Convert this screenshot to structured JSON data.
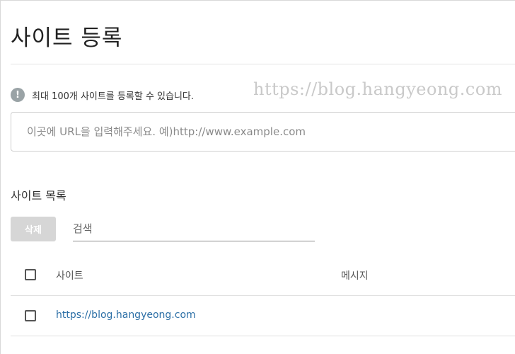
{
  "page": {
    "title": "사이트 등록"
  },
  "notice": {
    "icon": "exclamation-icon",
    "icon_glyph": "!",
    "text": "최대 100개 사이트를 등록할 수 있습니다."
  },
  "watermark": {
    "text": "https://blog.hangyeong.com"
  },
  "url_input": {
    "value": "",
    "placeholder": "이곳에 URL을 입력해주세요. 예)http://www.example.com"
  },
  "site_list": {
    "title": "사이트 목록",
    "delete_label": "삭제",
    "search": {
      "value": "",
      "placeholder": "검색"
    },
    "columns": {
      "site": "사이트",
      "message": "메시지"
    },
    "rows": [
      {
        "site": "https://blog.hangyeong.com",
        "message": "",
        "checked": false
      }
    ]
  },
  "colors": {
    "link": "#2c6fa6",
    "disabled_button": "#d6d6d6",
    "info_icon": "#9aa3a6"
  }
}
